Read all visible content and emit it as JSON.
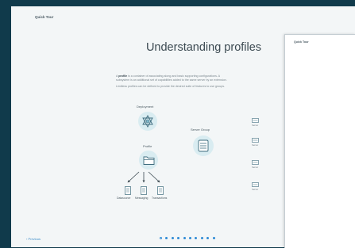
{
  "window": {
    "title": "Quick Tour"
  },
  "page": {
    "heading": "Understanding profiles",
    "para1_lead": "A ",
    "para1_term": "profile",
    "para1_rest": " is a container of associating along and basic supporting configurations. A",
    "para2": "subsystem is an additional set of capabilities added to the same server by an extension.",
    "para3": "Limitless profiles can be defined to provide the desired suite of features to use groups."
  },
  "diagram": {
    "deployment_label": "Deployment",
    "server_group_label": "Server Group",
    "profile_label": "Profile",
    "leaves": [
      {
        "label": "Datasource"
      },
      {
        "label": "Messaging"
      },
      {
        "label": "Transactions"
      }
    ],
    "servers": [
      "Server",
      "Server",
      "Server",
      "Server"
    ]
  },
  "card": {
    "title": "Quick Tour"
  },
  "footer": {
    "previous_label": "‹ Previous",
    "page_total": 10,
    "active_page": 1
  },
  "colors": {
    "background": "#103a4b",
    "panel": "#f3f6f7",
    "accent": "#2f8bd6",
    "icon_fill": "#d9ecf1",
    "icon_stroke": "#3d6b7d"
  }
}
